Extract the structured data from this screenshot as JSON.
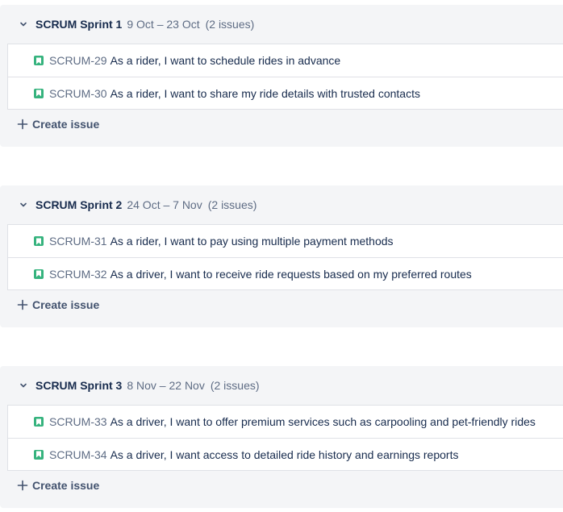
{
  "sprints": [
    {
      "name": "SCRUM Sprint 1",
      "dates": "9 Oct – 23 Oct",
      "count": "(2 issues)",
      "issues": [
        {
          "key": "SCRUM-29",
          "summary": "As a rider, I want to schedule rides in advance"
        },
        {
          "key": "SCRUM-30",
          "summary": "As a rider, I want to share my ride details with trusted contacts"
        }
      ],
      "create_label": "Create issue"
    },
    {
      "name": "SCRUM Sprint 2",
      "dates": "24 Oct – 7 Nov",
      "count": "(2 issues)",
      "issues": [
        {
          "key": "SCRUM-31",
          "summary": "As a rider, I want to pay using multiple payment methods"
        },
        {
          "key": "SCRUM-32",
          "summary": "As a driver, I want to receive ride requests based on my preferred routes"
        }
      ],
      "create_label": "Create issue"
    },
    {
      "name": "SCRUM Sprint 3",
      "dates": "8 Nov – 22 Nov",
      "count": "(2 issues)",
      "issues": [
        {
          "key": "SCRUM-33",
          "summary": "As a driver, I want to offer premium services such as carpooling and pet-friendly rides"
        },
        {
          "key": "SCRUM-34",
          "summary": "As a driver, I want access to detailed ride history and earnings reports"
        }
      ],
      "create_label": "Create issue"
    }
  ],
  "icons": {
    "collapse": "chevron-down-icon",
    "issue_type": "story-icon",
    "create": "plus-icon"
  },
  "colors": {
    "story": "#36b37e",
    "panel_bg": "#f4f5f7",
    "text": "#172b4d",
    "muted": "#5e6c84"
  }
}
